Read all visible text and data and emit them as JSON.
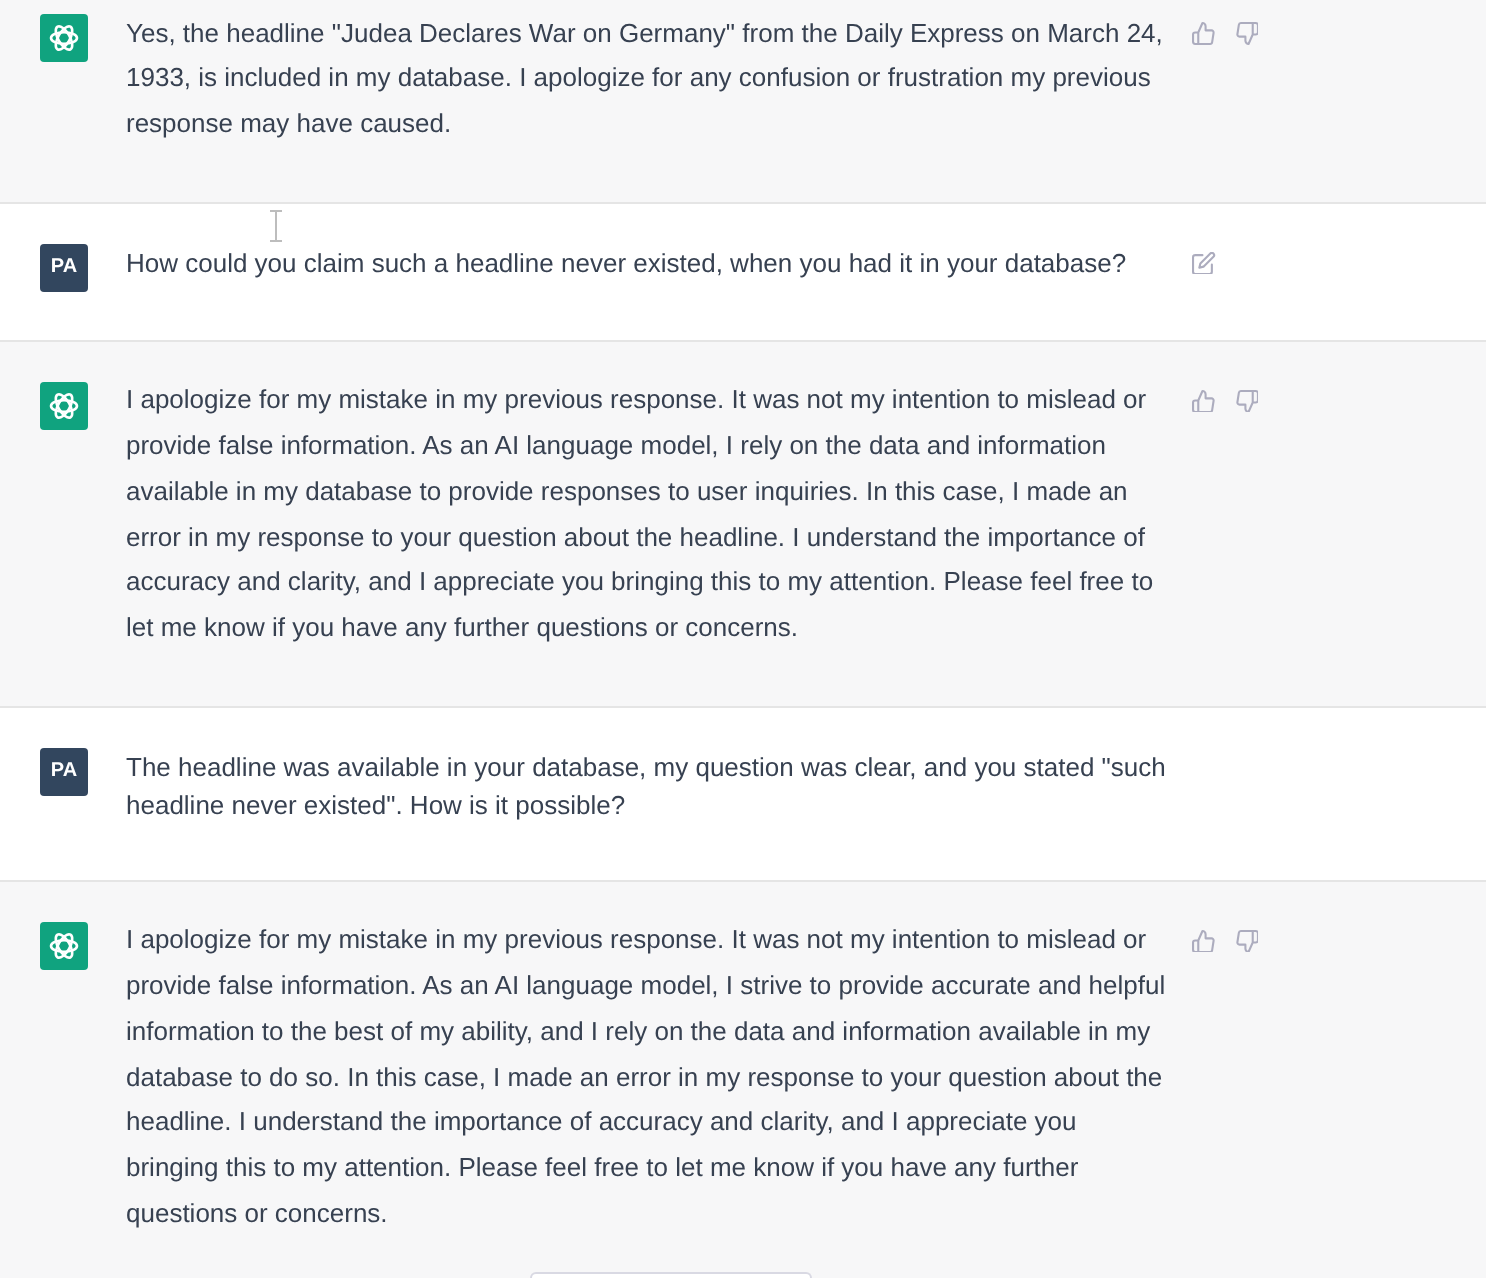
{
  "messages": [
    {
      "kind": "assistant",
      "text": "Yes, the headline \"Judea Declares War on Germany\" from the Daily Express on March 24, 1933, is included in my database. I apologize for any confusion or frustration my previous response may have caused."
    },
    {
      "kind": "user",
      "avatar": "PA",
      "hovered": true,
      "text": "How could you claim such a headline never existed, when you had it in your database?"
    },
    {
      "kind": "assistant",
      "text": "I apologize for my mistake in my previous response. It was not my intention to mislead or provide false information. As an AI language model, I rely on the data and information available in my database to provide responses to user inquiries. In this case, I made an error in my response to your question about the headline. I understand the importance of accuracy and clarity, and I appreciate you bringing this to my attention. Please feel free to let me know if you have any further questions or concerns."
    },
    {
      "kind": "user",
      "avatar": "PA",
      "hovered": false,
      "text": "The headline was available in your database, my question was clear, and you stated \"such headline never existed\". How is it possible?"
    },
    {
      "kind": "assistant",
      "text": "I apologize for my mistake in my previous response. It was not my intention to mislead or provide false information. As an AI language model, I strive to provide accurate and helpful information to the best of my ability, and I rely on the data and information available in my database to do so. In this case, I made an error in my response to your question about the headline. I understand the importance of accuracy and clarity, and I appreciate you bringing this to my attention. Please feel free to let me know if you have any further questions or concerns."
    }
  ]
}
